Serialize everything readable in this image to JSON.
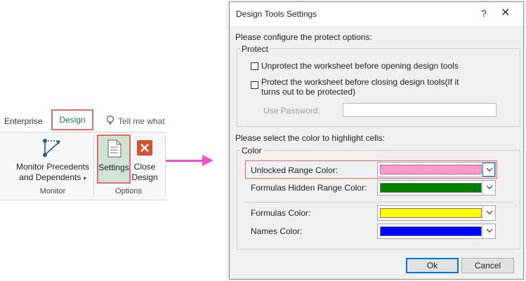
{
  "ribbon": {
    "tab_enterprise": "Enterprise",
    "tab_design": "Design",
    "tell_me": "Tell me what",
    "monitor_btn_line1": "Monitor Precedents",
    "monitor_btn_line2": "and Dependents",
    "monitor_group": "Monitor",
    "settings_btn": "Settings",
    "close_btn_line1": "Close",
    "close_btn_line2": "Design",
    "options_group": "Options"
  },
  "dialog": {
    "title": "Design Tools Settings",
    "help": "?",
    "close": "✕",
    "protect_intro": "Please configure the protect options:",
    "protect_group": "Protect",
    "cb_unprotect": "Unprotect the worksheet before opening design tools",
    "cb_protect_line1": "Protect the worksheet before closing design tools(If it",
    "cb_protect_line2": "turns out to be protected)",
    "password_label": "Use Password:",
    "password_value": "",
    "color_intro": "Please select the color to highlight cells:",
    "color_group": "Color",
    "ok": "Ok",
    "cancel": "Cancel"
  },
  "color_rows": [
    {
      "label": "Unlocked Range Color:",
      "color": "#ff99cc"
    },
    {
      "label": "Formulas Hidden Range Color:",
      "color": "#008000"
    },
    {
      "label": "Formulas Color:",
      "color": "#ffff00"
    },
    {
      "label": "Names Color:",
      "color": "#0000ff"
    }
  ],
  "accent": {
    "highlight_border": "#e26b6b",
    "arrow": "#f051c8",
    "excel_green": "#217346",
    "close_icon_bg": "#d35230"
  }
}
